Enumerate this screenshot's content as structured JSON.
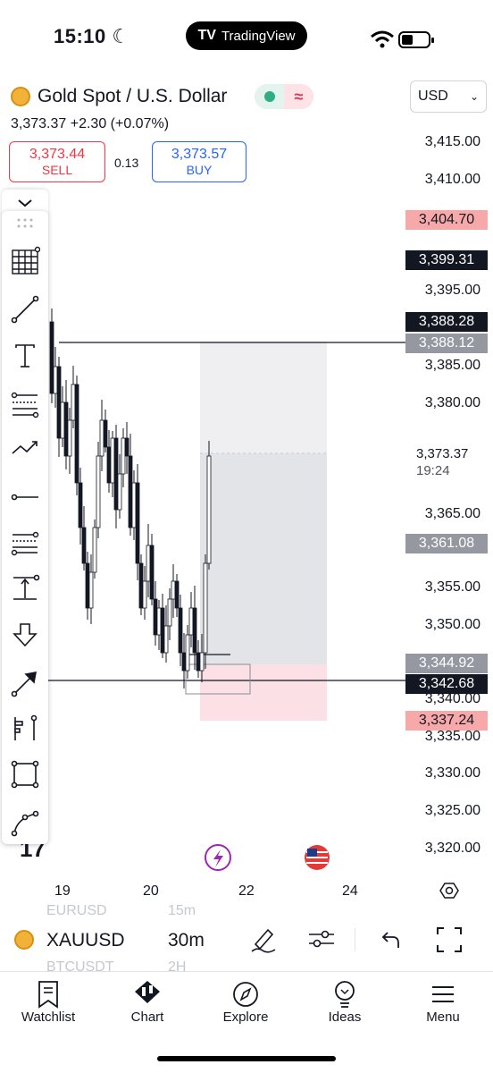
{
  "status_bar": {
    "time": "15:10",
    "app_pill": "TradingView"
  },
  "header": {
    "symbol_title": "Gold Spot / U.S. Dollar",
    "price_line": "3,373.37  +2.30 (+0.07%)",
    "currency": "USD",
    "sell": {
      "price": "3,373.44",
      "label": "SELL"
    },
    "spread": "0.13",
    "buy": {
      "price": "3,373.57",
      "label": "BUY"
    }
  },
  "price_axis": {
    "ticks": [
      "3,415.00",
      "3,410.00",
      "3,395.00",
      "3,385.00",
      "3,380.00",
      "3,365.00",
      "3,355.00",
      "3,350.00",
      "3,340.00",
      "3,335.00",
      "3,330.00",
      "3,325.00",
      "3,320.00"
    ],
    "tags": {
      "top_target": "3,404.70",
      "upper_black": "3,399.31",
      "line_high": "3,388.28",
      "line_high_gray": "3,388.12",
      "mid_gray": "3,361.08",
      "entry_gray": "3,344.92",
      "line_low": "3,342.68",
      "stop": "3,337.24"
    },
    "current_price": "3,373.37",
    "countdown": "19:24"
  },
  "date_axis": [
    "19",
    "20",
    "22",
    "24"
  ],
  "symbol_bar": {
    "ghost_top": {
      "symbol": "EURUSD",
      "interval": "15m"
    },
    "symbol": "XAUUSD",
    "interval": "30m",
    "ghost_bottom": {
      "symbol": "BTCUSDT",
      "interval": "2H"
    }
  },
  "tabs": [
    {
      "label": "Watchlist",
      "icon": "watchlist-icon"
    },
    {
      "label": "Chart",
      "icon": "chart-icon"
    },
    {
      "label": "Explore",
      "icon": "compass-icon"
    },
    {
      "label": "Ideas",
      "icon": "lightbulb-icon"
    },
    {
      "label": "Menu",
      "icon": "hamburger-icon"
    }
  ],
  "colors": {
    "sell": "#f23645",
    "buy": "#2962ff",
    "profit_zone": "#e6e7ea",
    "loss_zone": "#fbe3e6"
  }
}
